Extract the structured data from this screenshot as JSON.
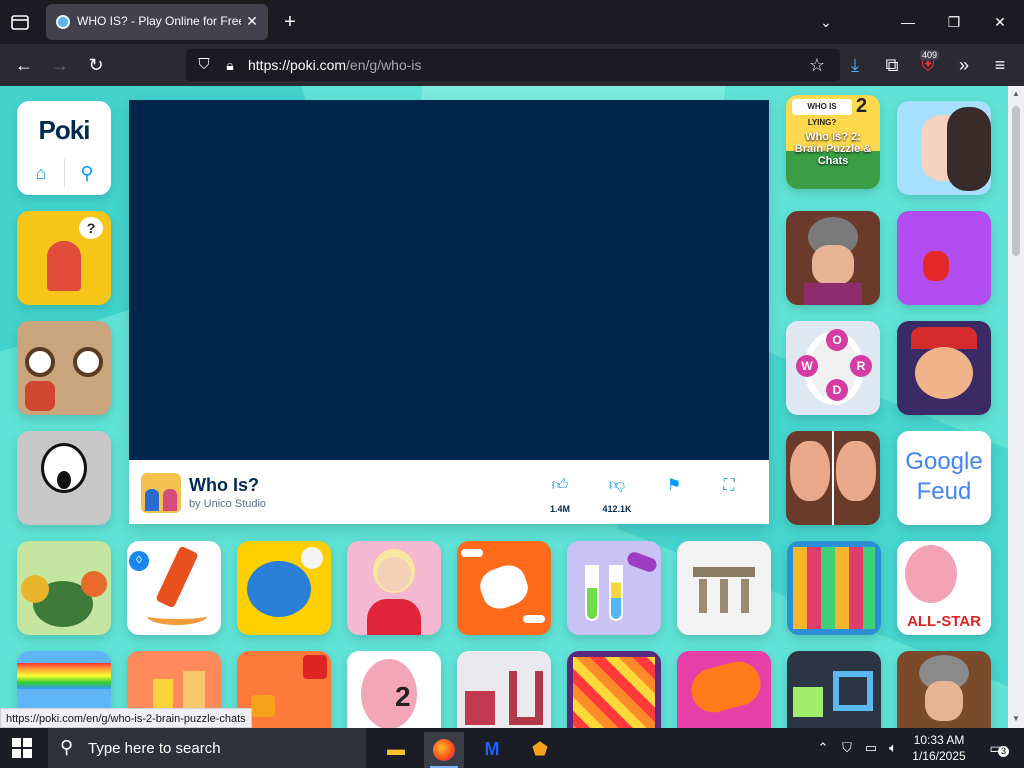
{
  "browser": {
    "tab_title": "WHO IS? - Play Online for Free!",
    "url_host": "https://poki.com",
    "url_path": "/en/g/who-is",
    "extension_badge": "409",
    "status_url": "https://poki.com/en/g/who-is-2-brain-puzzle-chats"
  },
  "site": {
    "logo": "Poki",
    "home_icon": "home-icon",
    "search_icon": "search-icon"
  },
  "game": {
    "title": "Who Is?",
    "developer": "by Unico Studio",
    "likes": "1.4M",
    "dislikes": "412.1K"
  },
  "tiles": {
    "who_is_2_label": "Who Is? 2: Brain Puzzle & Chats",
    "who_is_lying_text": "WHO IS LYING?",
    "google_feud_text": "Google Feud",
    "all_star_text": "ALL-STAR",
    "word_letters": "WORD"
  },
  "taskbar": {
    "search_placeholder": "Type here to search",
    "time": "10:33 AM",
    "date": "1/16/2025",
    "notifications": "3"
  },
  "colors": {
    "page_bg": "#5fe3d6",
    "game_screen": "#00264d",
    "accent": "#009cff"
  }
}
